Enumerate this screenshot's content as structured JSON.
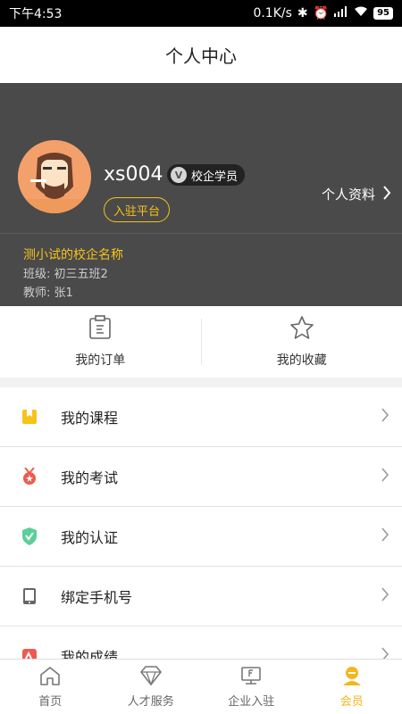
{
  "status_bar": {
    "time": "下午4:53",
    "network_speed": "0.1K/s",
    "battery": "95"
  },
  "page_title": "个人中心",
  "profile": {
    "username": "xs004",
    "badge_label": "校企学员",
    "join_button_label": "入驻平台",
    "profile_link_label": "个人资料",
    "school_name": "测小试的校企名称",
    "class_info": "班级: 初三五班2",
    "teacher_info": "教师: 张1"
  },
  "quick_actions": [
    {
      "label": "我的订单",
      "icon": "clipboard-icon"
    },
    {
      "label": "我的收藏",
      "icon": "star-icon"
    }
  ],
  "menu": [
    {
      "label": "我的课程",
      "icon": "bookmark-icon",
      "color": "#f6c319"
    },
    {
      "label": "我的考试",
      "icon": "medal-icon",
      "color": "#ef5a4f"
    },
    {
      "label": "我的认证",
      "icon": "shield-check-icon",
      "color": "#5ccf9a"
    },
    {
      "label": "绑定手机号",
      "icon": "phone-icon",
      "color": "#666666"
    },
    {
      "label": "我的成绩",
      "icon": "score-icon",
      "color": "#ef5a4f"
    }
  ],
  "tabs": [
    {
      "label": "首页",
      "icon": "home-icon",
      "active": false
    },
    {
      "label": "人才服务",
      "icon": "diamond-icon",
      "active": false
    },
    {
      "label": "企业入驻",
      "icon": "enterprise-icon",
      "active": false
    },
    {
      "label": "会员",
      "icon": "member-icon",
      "active": true
    }
  ],
  "colors": {
    "accent": "#f6b51b",
    "header_bg": "#4a4a4a"
  }
}
